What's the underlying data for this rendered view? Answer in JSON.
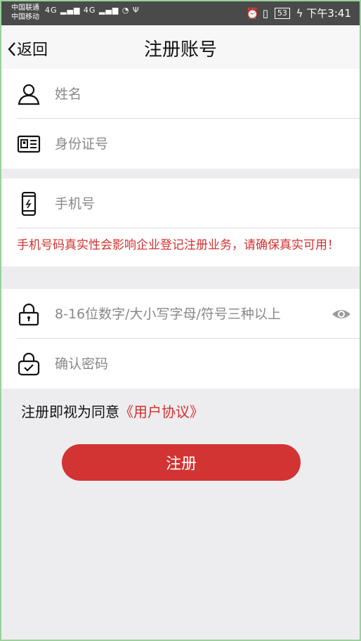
{
  "status_bar": {
    "carrier_1": "中国联通",
    "carrier_2": "中国移动",
    "network_1": "4G",
    "network_2": "4G",
    "battery": "53",
    "time": "下午3:41"
  },
  "header": {
    "back_label": "返回",
    "title": "注册账号"
  },
  "form": {
    "name_placeholder": "姓名",
    "id_placeholder": "身份证号",
    "phone_placeholder": "手机号",
    "phone_warning": "手机号码真实性会影响企业登记注册业务，请确保真实可用！",
    "password_placeholder": "8-16位数字/大小写字母/符号三种以上",
    "confirm_placeholder": "确认密码"
  },
  "agreement": {
    "prefix": "注册即视为同意",
    "link": "《用户协议》"
  },
  "register_label": "注册",
  "colors": {
    "accent": "#d23333",
    "warning": "#d2302e",
    "background": "#ededf0"
  }
}
